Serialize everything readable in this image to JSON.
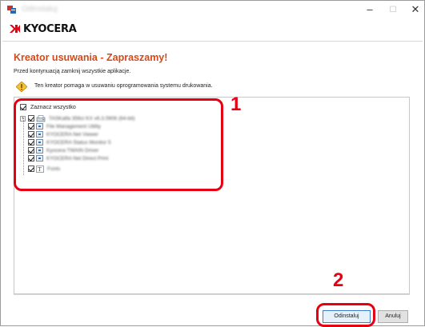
{
  "window": {
    "title": "Odinstaluj",
    "minimize_glyph": "–",
    "maximize_glyph": "☐",
    "close_glyph": "✕"
  },
  "brand": {
    "logo_text": "KYOCERA",
    "logo_icon": "kyocera-logo-icon"
  },
  "wizard": {
    "heading": "Kreator usuwania - Zapraszamy!",
    "instruction": "Przed kontynuacją zamknij wszystkie aplikacje.",
    "info_icon": "info-diamond-icon",
    "info_text": "Ten kreator pomaga w usuwaniu oprogramowania systemu drukowania."
  },
  "tree": {
    "select_all": {
      "label": "Zaznacz wszystko",
      "checked": true
    },
    "items": [
      {
        "label": "TASKalfa 356ci KX v6.3.0906 (64-bit)",
        "checked": true,
        "expandable": true
      },
      {
        "label": "File Management Utility",
        "checked": true
      },
      {
        "label": "KYOCERA Net Viewer",
        "checked": true
      },
      {
        "label": "KYOCERA Status Monitor 5",
        "checked": true
      },
      {
        "label": "Kyocera TWAIN Driver",
        "checked": true
      },
      {
        "label": "KYOCERA Net Direct Print",
        "checked": true
      },
      {
        "label": "Fonts",
        "checked": true
      }
    ]
  },
  "callouts": {
    "tree": "1",
    "button": "2"
  },
  "buttons": {
    "uninstall": "Odinstaluj",
    "cancel": "Anuluj"
  },
  "colors": {
    "heading": "#d24a1a",
    "callout_red": "#e60012",
    "logo_red": "#e60012"
  }
}
